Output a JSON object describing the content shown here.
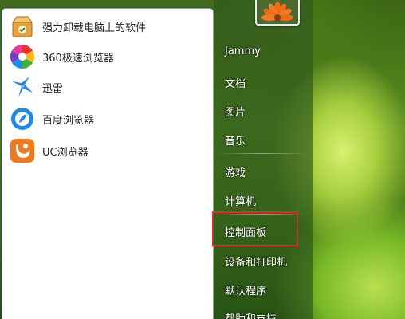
{
  "programs": [
    {
      "label": "强力卸载电脑上的软件",
      "icon": "uninstaller-box-icon"
    },
    {
      "label": "360极速浏览器",
      "icon": "360-browser-icon"
    },
    {
      "label": "迅雷",
      "icon": "xunlei-bird-icon"
    },
    {
      "label": "百度浏览器",
      "icon": "baidu-browser-icon"
    },
    {
      "label": "UC浏览器",
      "icon": "uc-browser-icon"
    }
  ],
  "user_picture": {
    "icon": "orange-flower-icon"
  },
  "links": [
    {
      "label": "Jammy"
    },
    {
      "label": "文档"
    },
    {
      "label": "图片"
    },
    {
      "label": "音乐"
    },
    {
      "label": "游戏"
    },
    {
      "label": "计算机"
    },
    {
      "label": "控制面板"
    },
    {
      "label": "设备和打印机"
    },
    {
      "label": "默认程序"
    },
    {
      "label": "帮助和支持"
    }
  ],
  "highlighted_item": "控制面板",
  "colors": {
    "highlight_border": "#e22a2a",
    "links_text": "#ffffff",
    "programs_bg": "#ffffff"
  }
}
